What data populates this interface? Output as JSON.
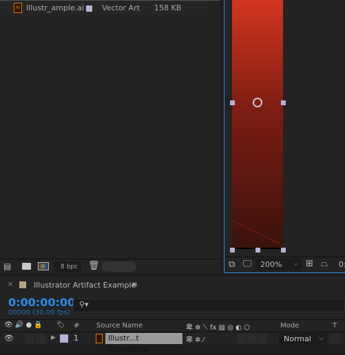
{
  "project": {
    "item": {
      "name": "Illustr_ample.ai",
      "type": "Vector Art",
      "size": "158 KB",
      "label_color": "#b4b4d8",
      "icon": "illustrator-file-icon"
    },
    "footer": {
      "bpc": "8 bpc",
      "icons": [
        "interpret-footage-icon",
        "new-folder-icon",
        "new-composition-icon",
        "trash-icon"
      ]
    }
  },
  "viewer": {
    "zoom": "200%",
    "timecode_partial": "0:",
    "layer_gradient": [
      "#d33520",
      "#3a120d"
    ],
    "icons": [
      "snapshot-icon",
      "display-icon",
      "region-of-interest-icon",
      "transparency-grid-icon"
    ]
  },
  "timeline": {
    "comp_name": "Illustrator Artifact Example",
    "comp_color": "#b4a584",
    "timecode": "0:00:00:00",
    "frame_info": "00000 (30.00 fps)",
    "columns": {
      "number": "#",
      "source_name": "Source Name",
      "mode": "Mode",
      "t": "T"
    },
    "layers": [
      {
        "number": "1",
        "name": "Illustr...t Example.ai",
        "mode": "Normal",
        "label_color": "#b4b4d8"
      }
    ]
  }
}
